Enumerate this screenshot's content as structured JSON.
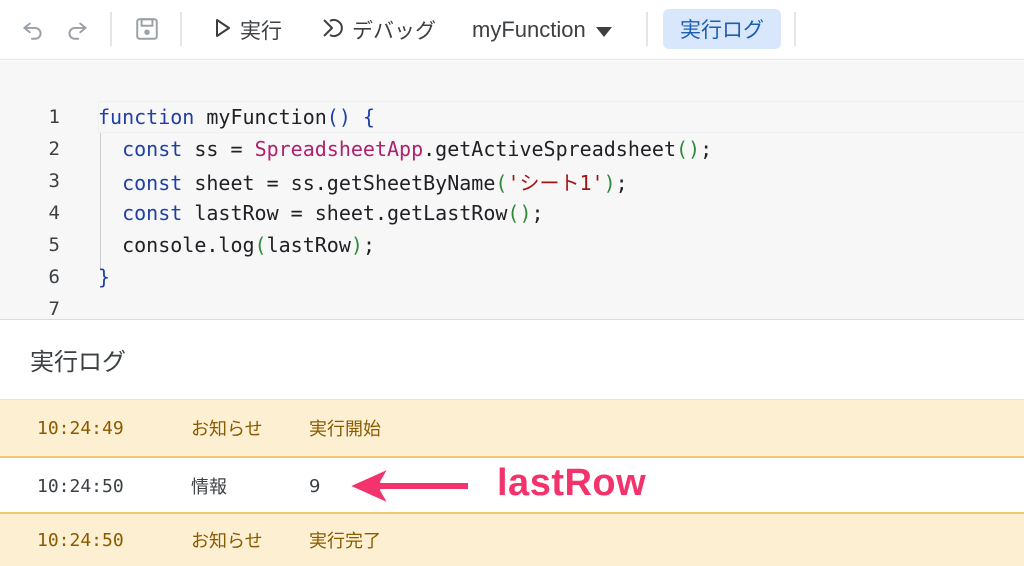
{
  "toolbar": {
    "run_label": "実行",
    "debug_label": "デバッグ",
    "function_selected": "myFunction",
    "log_button_label": "実行ログ"
  },
  "editor": {
    "line_numbers": [
      "1",
      "2",
      "3",
      "4",
      "5",
      "6",
      "7"
    ]
  },
  "log": {
    "title": "実行ログ",
    "rows": [
      {
        "time": "10:24:49",
        "type": "お知らせ",
        "message": "実行開始",
        "level": "notice"
      },
      {
        "time": "10:24:50",
        "type": "情報",
        "message": "9",
        "level": "info"
      },
      {
        "time": "10:24:50",
        "type": "お知らせ",
        "message": "実行完了",
        "level": "notice"
      }
    ]
  },
  "annotation": {
    "label": "lastRow",
    "color": "#f2336c"
  },
  "colors": {
    "accent": "#1a5fb4",
    "notice_bg": "#fdf0d2",
    "keyword": "#1f3fa6",
    "class": "#b0206c",
    "string": "#a31515"
  }
}
